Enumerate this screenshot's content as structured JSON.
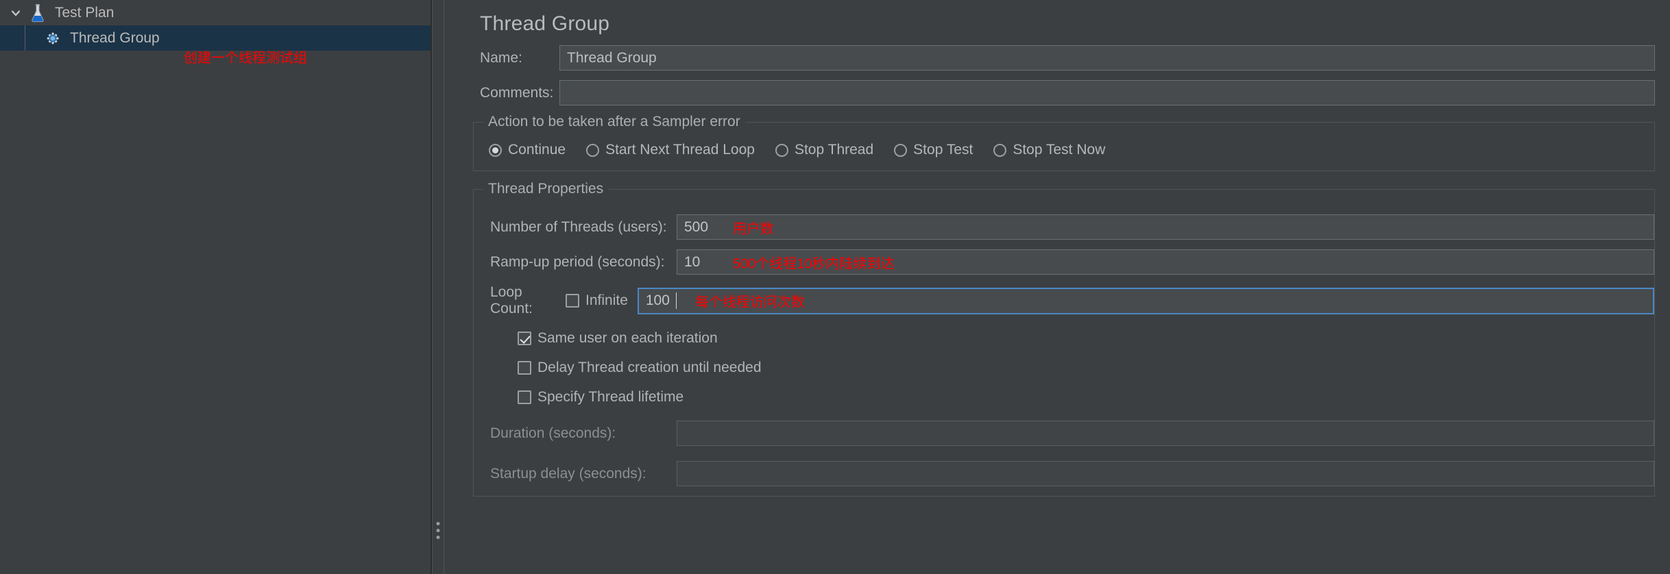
{
  "app": {
    "accent_color": "#4a88c7",
    "annotation_color": "#ff0000",
    "selection_color": "#1b3347"
  },
  "tree": {
    "nodes": [
      {
        "label": "Test Plan",
        "icon": "flask-icon",
        "expanded": true,
        "selected": false,
        "level": 0
      },
      {
        "label": "Thread Group",
        "icon": "thread-group-icon",
        "expanded": false,
        "selected": true,
        "level": 1
      }
    ],
    "annotation": "创建一个线程测试组"
  },
  "editor": {
    "title": "Thread Group",
    "name": {
      "label": "Name:",
      "value": "Thread Group"
    },
    "comments": {
      "label": "Comments:",
      "value": ""
    },
    "sampler_error_group": {
      "title": "Action to be taken after a Sampler error",
      "options": [
        {
          "label": "Continue",
          "checked": true
        },
        {
          "label": "Start Next Thread Loop",
          "checked": false
        },
        {
          "label": "Stop Thread",
          "checked": false
        },
        {
          "label": "Stop Test",
          "checked": false
        },
        {
          "label": "Stop Test Now",
          "checked": false
        }
      ]
    },
    "thread_properties": {
      "title": "Thread Properties",
      "num_threads": {
        "label": "Number of Threads (users):",
        "value": "500",
        "annotation": "用户数"
      },
      "ramp_up": {
        "label": "Ramp-up period (seconds):",
        "value": "10",
        "annotation": "500个线程10秒内陆续到达"
      },
      "loop_count": {
        "label": "Loop Count:",
        "infinite_label": "Infinite",
        "infinite_checked": false,
        "value": "100",
        "annotation": "每个线程访问次数",
        "focused": true
      },
      "checkboxes": [
        {
          "label": "Same user on each iteration",
          "checked": true
        },
        {
          "label": "Delay Thread creation until needed",
          "checked": false
        },
        {
          "label": "Specify Thread lifetime",
          "checked": false
        }
      ],
      "duration": {
        "label": "Duration (seconds):",
        "value": "",
        "disabled": true
      },
      "startup_delay": {
        "label": "Startup delay (seconds):",
        "value": "",
        "disabled": true
      }
    }
  }
}
